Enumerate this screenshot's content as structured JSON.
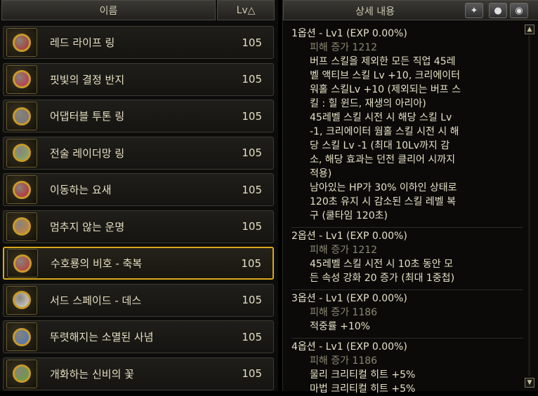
{
  "list": {
    "header_name": "이름",
    "header_lv": "Lv△",
    "items": [
      {
        "name": "레드 라이프 링",
        "lv": "105",
        "icon": "red-life-ring-icon",
        "color": "#b8322e"
      },
      {
        "name": "핏빛의 결정 반지",
        "lv": "105",
        "icon": "blood-crystal-ring-icon",
        "color": "#c9304a"
      },
      {
        "name": "어댑터블 투톤 링",
        "lv": "105",
        "icon": "adaptable-twotone-ring-icon",
        "color": "#7a7a7a"
      },
      {
        "name": "전술 레이더망 링",
        "lv": "105",
        "icon": "tactical-radar-ring-icon",
        "color": "#8bb26a"
      },
      {
        "name": "이동하는 요새",
        "lv": "105",
        "icon": "moving-fortress-icon",
        "color": "#c8232f"
      },
      {
        "name": "멈추지 않는 운명",
        "lv": "105",
        "icon": "unstoppable-fate-icon",
        "color": "#d18a3b"
      },
      {
        "name": "수호룡의 비호 - 축복",
        "lv": "105",
        "icon": "guardian-dragon-icon",
        "color": "#c8373a"
      },
      {
        "name": "서드 스페이드 - 데스",
        "lv": "105",
        "icon": "third-spade-death-icon",
        "color": "#dcdcdc"
      },
      {
        "name": "뚜렷해지는 소멸된 사념",
        "lv": "105",
        "icon": "vanished-thought-icon",
        "color": "#4a7ac8"
      },
      {
        "name": "개화하는 신비의 꽃",
        "lv": "105",
        "icon": "blooming-flower-icon",
        "color": "#6aa83a"
      }
    ],
    "selected_index": 6
  },
  "detail": {
    "header_title": "상세 내용",
    "buttons": [
      {
        "name": "compare-button",
        "icon": "wings-icon",
        "glyph": "✦"
      },
      {
        "name": "pin-button",
        "icon": "pin-icon",
        "glyph": "●"
      },
      {
        "name": "view-button",
        "icon": "eye-icon",
        "glyph": "◉"
      }
    ],
    "options": [
      {
        "title": "1옵션 - Lv1 (EXP 0.00%)",
        "damage": "피해 증가 1212",
        "lines": [
          "버프 스킬을 제외한 모든 직업 45레",
          "벨 액티브 스킬 Lv +10, 크리에이터",
          "워홀 스킬Lv +10 (제외되는 버프 스",
          "킬 : 힐 윈드, 재생의 아리아)",
          "45레벨 스킬 시전 시 해당 스킬 Lv",
          "-1, 크리에이터 웜홀 스킬 시전 시 해",
          "당 스킬 Lv -1 (최대 10Lv까지 감",
          "소, 해당 효과는 던전 클리어 시까지",
          "적용)",
          "남아있는 HP가 30% 이하인 상태로",
          "120초 유지 시 감소된 스킬 레벨 복",
          "구 (쿨타임 120초)"
        ]
      },
      {
        "title": "2옵션 - Lv1 (EXP 0.00%)",
        "damage": "피해 증가 1212",
        "lines": [
          "45레벨 스킬 시전 시 10초 동안 모",
          "든 속성 강화 20 증가 (최대 1중첩)"
        ]
      },
      {
        "title": "3옵션 - Lv1 (EXP 0.00%)",
        "damage": "피해 증가 1186",
        "lines": [
          "적중률 +10%"
        ]
      },
      {
        "title": "4옵션 - Lv1 (EXP 0.00%)",
        "damage": "피해 증가 1186",
        "lines": [
          "물리 크리티컬 히트 +5%",
          "마법 크리티컬 히트 +5%"
        ]
      }
    ]
  }
}
